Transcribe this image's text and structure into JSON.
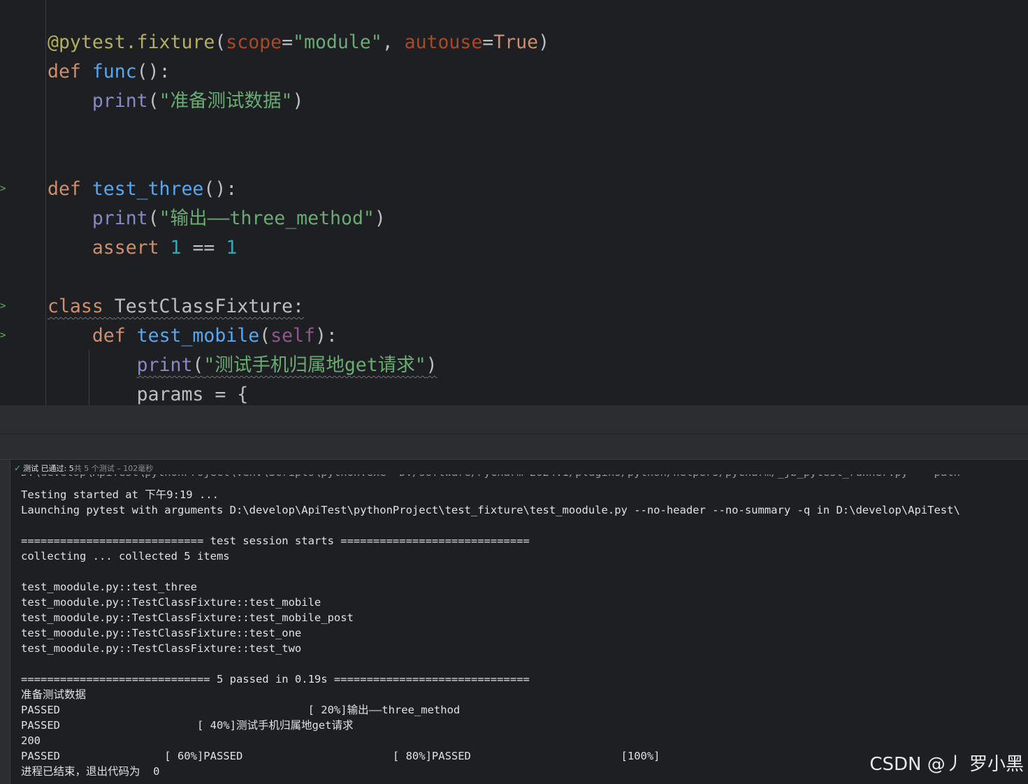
{
  "editor": {
    "lines": [
      {
        "id": "fixture-decorator",
        "tokens": [
          {
            "c": "dec",
            "t": "@pytest.fixture"
          },
          {
            "c": "cn",
            "t": "("
          },
          {
            "c": "prm",
            "t": "scope"
          },
          {
            "c": "cn",
            "t": "="
          },
          {
            "c": "str",
            "t": "\"module\""
          },
          {
            "c": "cn",
            "t": ", "
          },
          {
            "c": "prm",
            "t": "autouse"
          },
          {
            "c": "cn",
            "t": "="
          },
          {
            "c": "kw",
            "t": "True"
          },
          {
            "c": "cn",
            "t": ")"
          }
        ]
      },
      {
        "id": "def-func",
        "tokens": [
          {
            "c": "kw",
            "t": "def "
          },
          {
            "c": "fn",
            "t": "func"
          },
          {
            "c": "cn",
            "t": "():"
          }
        ]
      },
      {
        "id": "print-prepare",
        "tokens": [
          {
            "c": "cn",
            "t": "    "
          },
          {
            "c": "bi",
            "t": "print"
          },
          {
            "c": "cn",
            "t": "("
          },
          {
            "c": "str",
            "t": "\"准备测试数据\""
          },
          {
            "c": "cn",
            "t": ")"
          }
        ]
      },
      {
        "id": "def-test-three",
        "tokens": [
          {
            "c": "kw",
            "t": "def "
          },
          {
            "c": "fn",
            "t": "test_three"
          },
          {
            "c": "cn",
            "t": "():"
          }
        ]
      },
      {
        "id": "print-three",
        "tokens": [
          {
            "c": "cn",
            "t": "    "
          },
          {
            "c": "bi",
            "t": "print"
          },
          {
            "c": "cn",
            "t": "("
          },
          {
            "c": "str",
            "t": "\"输出——three_method\""
          },
          {
            "c": "cn",
            "t": ")"
          }
        ]
      },
      {
        "id": "assert-line",
        "tokens": [
          {
            "c": "cn",
            "t": "    "
          },
          {
            "c": "kw",
            "t": "assert "
          },
          {
            "c": "num",
            "t": "1"
          },
          {
            "c": "cn",
            "t": " == "
          },
          {
            "c": "num",
            "t": "1"
          }
        ]
      },
      {
        "id": "class-def",
        "tokens": [
          {
            "c": "kw wavy",
            "t": "class "
          },
          {
            "c": "cn wavy",
            "t": "TestClassFixture:"
          }
        ]
      },
      {
        "id": "def-test-mobile",
        "tokens": [
          {
            "c": "cn",
            "t": "    "
          },
          {
            "c": "kw",
            "t": "def "
          },
          {
            "c": "fn",
            "t": "test_mobile"
          },
          {
            "c": "cn",
            "t": "("
          },
          {
            "c": "self",
            "t": "self"
          },
          {
            "c": "cn",
            "t": "):"
          }
        ]
      },
      {
        "id": "print-mobile",
        "tokens": [
          {
            "c": "cn",
            "t": "        "
          },
          {
            "c": "bi wavy",
            "t": "print"
          },
          {
            "c": "cn wavy",
            "t": "("
          },
          {
            "c": "str wavy",
            "t": "\"测试手机归属地get请求\""
          },
          {
            "c": "cn wavy",
            "t": ")"
          }
        ]
      },
      {
        "id": "params-line",
        "tokens": [
          {
            "c": "cn",
            "t": "        params = {"
          }
        ]
      }
    ]
  },
  "status": {
    "label": "测试",
    "passed": "已通过: 5",
    "summary": "共 5 个测试 – 102毫秒"
  },
  "console": {
    "cropped_line": "D:\\develop\\ApiTest\\pythonProject\\venv\\Scripts\\python.exe \"D:/software/PyCharm 2024.1/plugins/python/helpers/pycharm/_jb_pytest_runner.py\" --path",
    "lines": [
      "Testing started at 下午9:19 ...",
      "Launching pytest with arguments D:\\develop\\ApiTest\\pythonProject\\test_fixture\\test_moodule.py --no-header --no-summary -q in D:\\develop\\ApiTest\\",
      "",
      "============================ test session starts =============================",
      "collecting ... collected 5 items",
      "",
      "test_moodule.py::test_three",
      "test_moodule.py::TestClassFixture::test_mobile",
      "test_moodule.py::TestClassFixture::test_mobile_post",
      "test_moodule.py::TestClassFixture::test_one",
      "test_moodule.py::TestClassFixture::test_two",
      "",
      "============================= 5 passed in 0.19s ==============================",
      "准备测试数据",
      "PASSED                                      [ 20%]输出——three_method",
      "PASSED                     [ 40%]测试手机归属地get请求",
      "200",
      "PASSED                [ 60%]PASSED                       [ 80%]PASSED                       [100%]",
      "进程已结束，退出代码为  0"
    ]
  },
  "watermark": "CSDN @丿 罗小黑"
}
